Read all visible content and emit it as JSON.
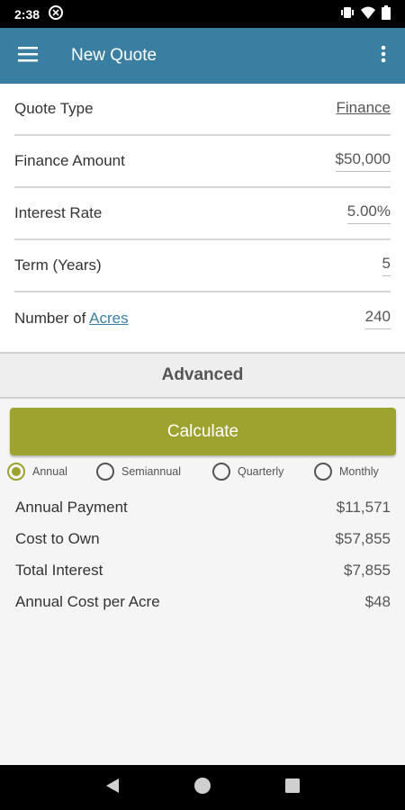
{
  "status_bar": {
    "time": "2:38"
  },
  "app_bar": {
    "title": "New Quote",
    "menu_icon": "hamburger-menu-icon",
    "more_icon": "more-vertical-icon"
  },
  "form": {
    "quote_type": {
      "label": "Quote Type",
      "value": "Finance"
    },
    "finance_amount": {
      "label": "Finance Amount",
      "value": "$50,000"
    },
    "interest_rate": {
      "label": "Interest Rate",
      "value": "5.00%"
    },
    "term": {
      "label": "Term (Years)",
      "value": "5"
    },
    "acres": {
      "label_prefix": "Number of ",
      "label_link": "Acres",
      "value": "240"
    }
  },
  "advanced": {
    "label": "Advanced"
  },
  "calculate": {
    "label": "Calculate"
  },
  "frequency": {
    "options": [
      "Annual",
      "Semiannual",
      "Quarterly",
      "Monthly"
    ],
    "selected": "Annual"
  },
  "results": [
    {
      "label": "Annual Payment",
      "value": "$11,571"
    },
    {
      "label": "Cost to Own",
      "value": "$57,855"
    },
    {
      "label": "Total Interest",
      "value": "$7,855"
    },
    {
      "label": "Annual Cost per Acre",
      "value": "$48"
    }
  ],
  "colors": {
    "app_bar": "#3a7fa2",
    "accent": "#9ea330",
    "link": "#3a7fa2"
  }
}
